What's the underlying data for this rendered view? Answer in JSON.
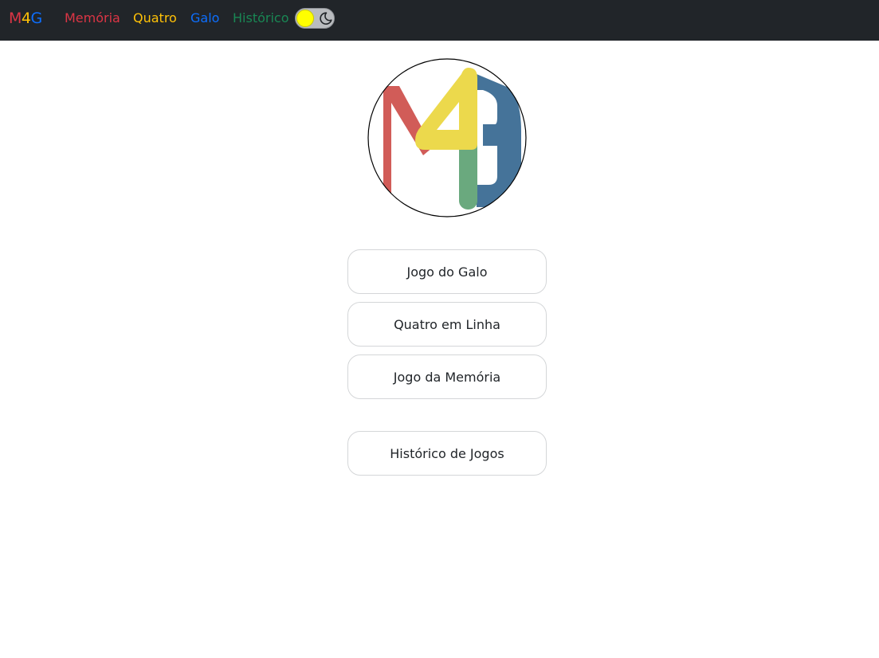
{
  "navbar": {
    "brand": {
      "letters": [
        "M",
        "4",
        "G"
      ],
      "colors": [
        "#dc3545",
        "#ffc107",
        "#0d6efd"
      ]
    },
    "links": [
      {
        "label": "Memória",
        "color": "#dc3545"
      },
      {
        "label": "Quatro",
        "color": "#ffc107"
      },
      {
        "label": "Galo",
        "color": "#0d6efd"
      },
      {
        "label": "Histórico",
        "color": "#198754"
      }
    ],
    "theme_toggle": {
      "state": "light",
      "knob_color": "#ffff00",
      "icon": "moon-icon"
    }
  },
  "logo": {
    "icon": "m4g-logo",
    "colors": {
      "m": "#d15c58",
      "four": "#ecd94c",
      "g": "#457399",
      "g_stem": "#6aa97e"
    }
  },
  "menu": {
    "buttons": [
      {
        "label": "Jogo do Galo"
      },
      {
        "label": "Quatro em Linha"
      },
      {
        "label": "Jogo da Memória"
      },
      {
        "label": "Histórico de Jogos"
      }
    ]
  }
}
